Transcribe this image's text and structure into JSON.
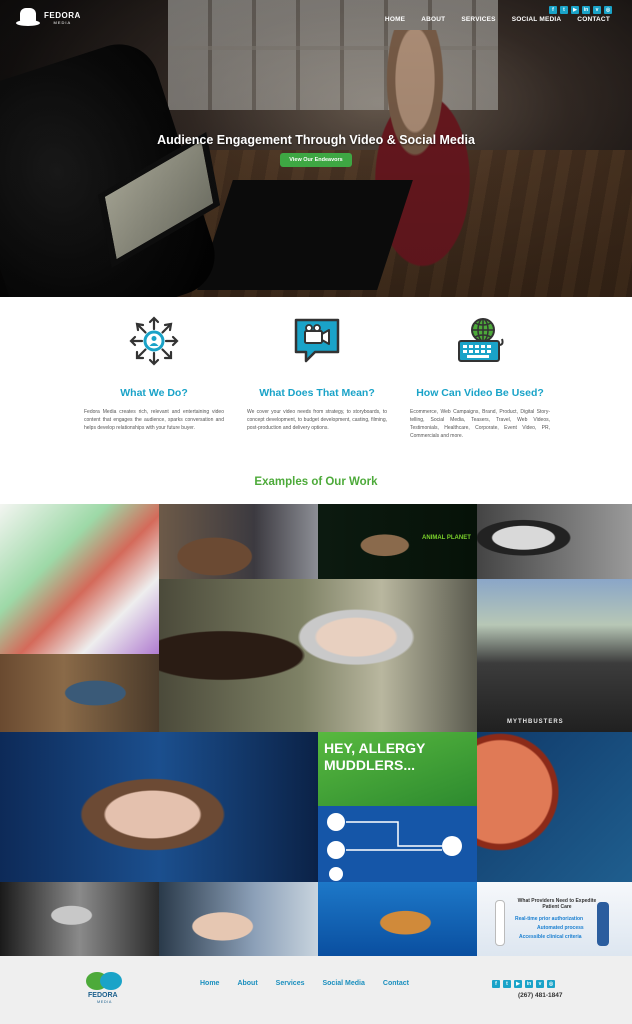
{
  "brand": {
    "name": "FEDORA",
    "tagline": "MEDIA"
  },
  "nav": {
    "items": [
      "HOME",
      "ABOUT",
      "SERVICES",
      "SOCIAL MEDIA",
      "CONTACT"
    ]
  },
  "social": {
    "icons": [
      "facebook-icon",
      "twitter-icon",
      "youtube-icon",
      "linkedin-icon",
      "vimeo-icon",
      "instagram-icon"
    ],
    "glyphs": [
      "f",
      "t",
      "▶",
      "in",
      "v",
      "◎"
    ]
  },
  "hero": {
    "title": "Audience Engagement Through Video & Social Media",
    "button": "View Our Endeavors"
  },
  "features": [
    {
      "icon": "audience-network-icon",
      "title": "What We Do?",
      "text": "Fedora Media creates rich, relevant and entertaining video content that engages the audience, sparks conversation and helps develop relationships with your future buyer."
    },
    {
      "icon": "video-chat-icon",
      "title": "What Does That Mean?",
      "text": "We cover your video needs from strategy, to storyboards, to concept development, to budget development, casting, filming, post-production and delivery options."
    },
    {
      "icon": "globe-keyboard-icon",
      "title": "How Can Video Be Used?",
      "text": "Ecommerce, Web Campaigns, Brand, Product, Digital Story-telling, Social Media, Teasers, Travel, Web Videos, Testimonials, Healthcare, Corporate, Event Video, PR, Commercials and more."
    }
  ],
  "examples": {
    "title": "Examples of Our Work",
    "captions": {
      "animal_planet": "ANIMAL PLANET",
      "allergy": "HEY, ALLERGY MUDDLERS...",
      "mythbusters": "MYTHBUSTERS",
      "providers_title": "What Providers Need to Expedite Patient Care",
      "providers_items": [
        "Real-time prior authorization",
        "Automated process",
        "Accessible clinical criteria"
      ]
    }
  },
  "footer": {
    "nav": [
      "Home",
      "About",
      "Services",
      "Social Media",
      "Contact"
    ],
    "phone": "(267) 481-1847"
  },
  "colors": {
    "teal": "#1aa3c8",
    "green": "#4daa3a",
    "button_green": "#3ea743",
    "footer_bg": "#efefef"
  }
}
